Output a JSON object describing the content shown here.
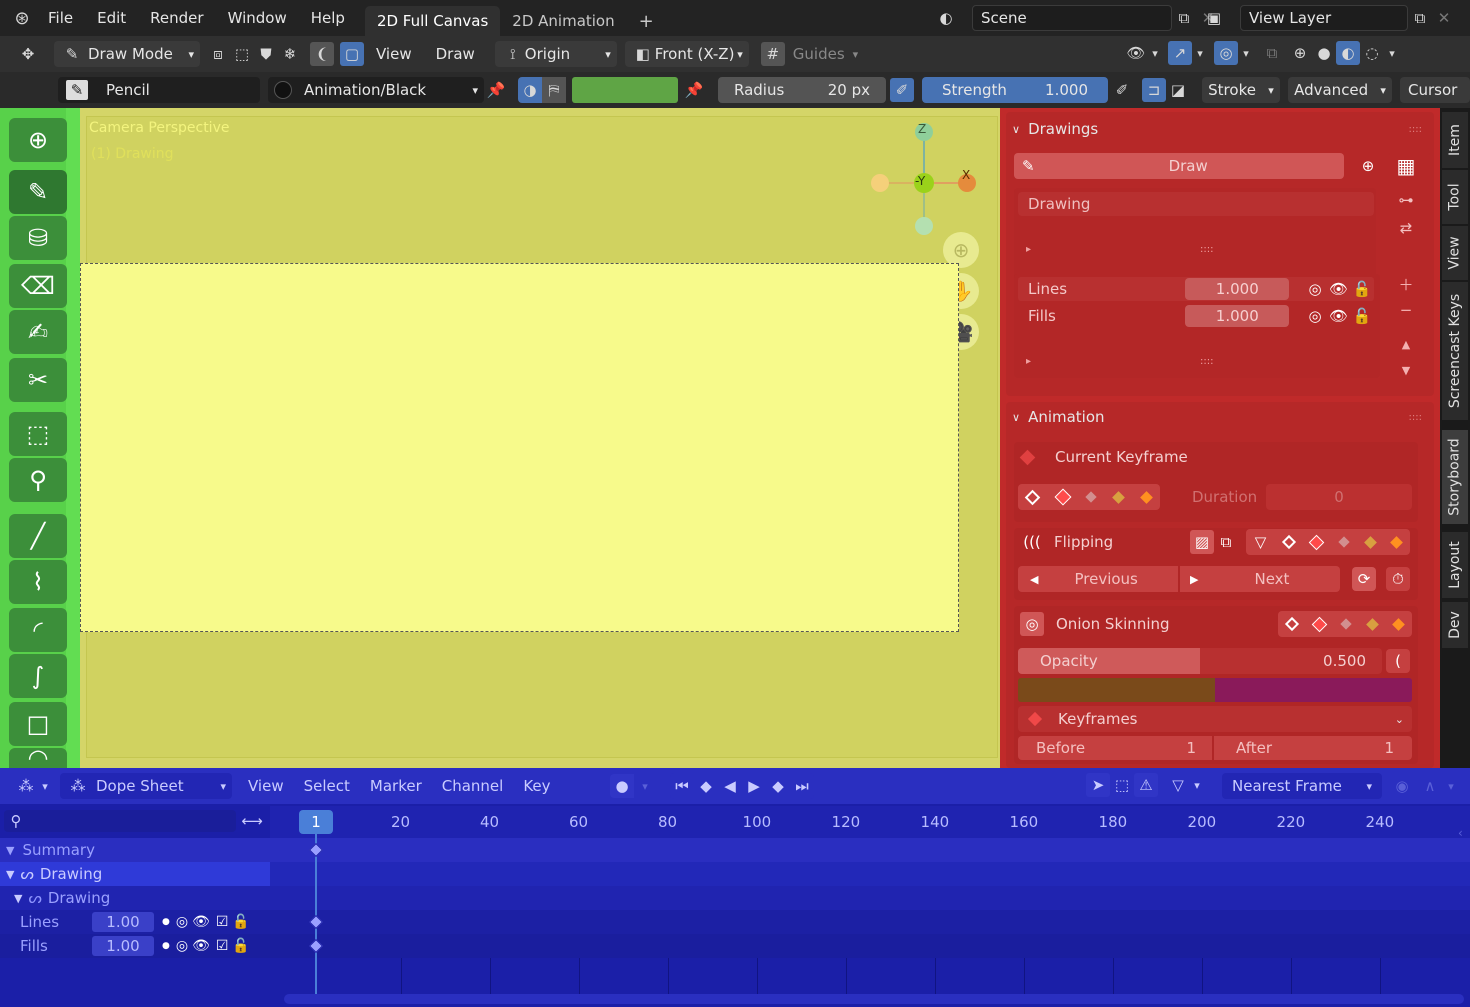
{
  "topbar": {
    "menus": [
      "File",
      "Edit",
      "Render",
      "Window",
      "Help"
    ],
    "workspaces": [
      "2D Full Canvas",
      "2D Animation"
    ],
    "add_workspace": "+",
    "scene": "Scene",
    "view_layer": "View Layer"
  },
  "header": {
    "mode": "Draw Mode",
    "view": "View",
    "draw": "Draw",
    "origin": "Origin",
    "projection": "Front (X-Z)",
    "guides": "Guides"
  },
  "toolsettings": {
    "brush": "Pencil",
    "material": "Animation/Black",
    "radius_label": "Radius",
    "radius_value": "20 px",
    "strength_label": "Strength",
    "strength_value": "1.000",
    "stroke": "Stroke",
    "advanced": "Advanced",
    "cursor": "Cursor"
  },
  "viewport": {
    "title": "Camera Perspective",
    "subtitle": "(1) Drawing",
    "gizmo": {
      "z": "Z",
      "y": "-Y",
      "x": "X"
    }
  },
  "npanel": {
    "drawings": {
      "header": "Drawings",
      "draw_button": "Draw",
      "drawing_item": "Drawing",
      "layers": [
        {
          "name": "Lines",
          "value": "1.000"
        },
        {
          "name": "Fills",
          "value": "1.000"
        }
      ]
    },
    "animation": {
      "header": "Animation",
      "current_keyframe": "Current Keyframe",
      "duration_label": "Duration",
      "duration_value": "0",
      "flipping": "Flipping",
      "previous": "Previous",
      "next": "Next",
      "onion_skinning": "Onion Skinning",
      "opacity_label": "Opacity",
      "opacity_value": "0.500",
      "opacity_fraction": 0.5,
      "keyframes": "Keyframes",
      "before_label": "Before",
      "before_value": "1",
      "after_label": "After",
      "after_value": "1",
      "before_color": "#7a4a1a",
      "after_color": "#8a1a5a"
    },
    "tabs": [
      "Item",
      "Tool",
      "View",
      "Screencast Keys",
      "Storyboard",
      "Layout",
      "Dev"
    ]
  },
  "dopesheet": {
    "editor": "Dope Sheet",
    "menus": [
      "View",
      "Select",
      "Marker",
      "Channel",
      "Key"
    ],
    "snap": "Nearest Frame",
    "current_frame": "1",
    "frame_ticks": [
      "20",
      "40",
      "60",
      "80",
      "100",
      "120",
      "140",
      "160",
      "180",
      "200",
      "220",
      "240"
    ],
    "channels": {
      "summary": "Summary",
      "object": "Drawing",
      "data": "Drawing",
      "layers": [
        {
          "name": "Lines",
          "value": "1.00"
        },
        {
          "name": "Fills",
          "value": "1.00"
        }
      ]
    }
  },
  "colors": {
    "viewport_bg": "#d4d568",
    "camera_bg": "#f7fa8b",
    "toolbar_green": "#58d14a",
    "npanel_red": "#c02a2a",
    "dopesheet_blue": "#1b1fa8"
  }
}
